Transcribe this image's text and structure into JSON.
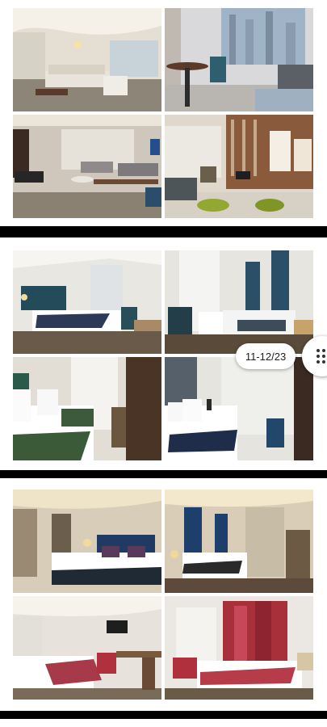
{
  "scroll_chip": {
    "date_range": "11-12/23"
  },
  "fab": {
    "icon": "drag-handle-icon"
  },
  "albums": [
    {
      "theme": "living-room-gallery",
      "photos": 4
    },
    {
      "theme": "bedroom-gallery",
      "photos": 4
    },
    {
      "theme": "suite-gallery",
      "photos": 4
    }
  ]
}
